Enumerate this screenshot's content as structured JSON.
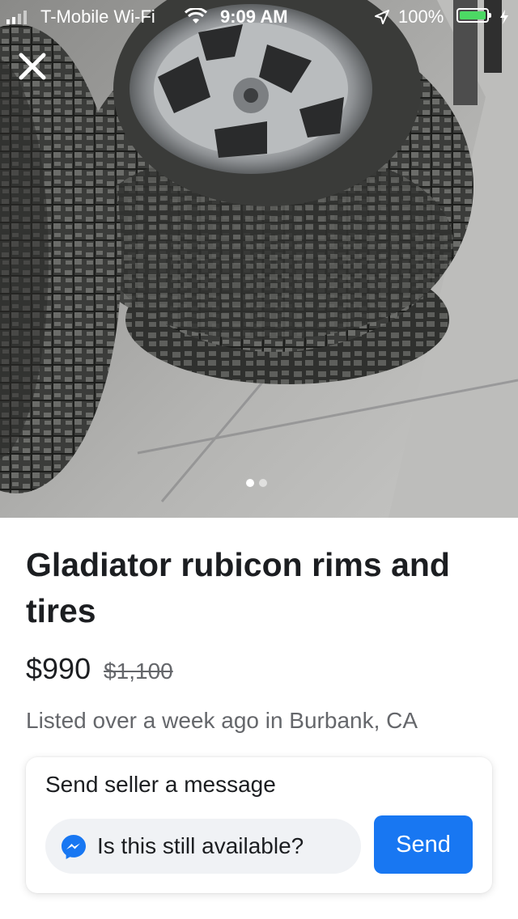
{
  "status_bar": {
    "carrier": "T-Mobile Wi-Fi",
    "time": "9:09 AM",
    "battery": "100%"
  },
  "photo": {
    "page_count": 2,
    "current_page": 1
  },
  "listing": {
    "title": "Gladiator rubicon rims and tires",
    "price": "$990",
    "original_price": "$1,100",
    "listed": "Listed over a week ago in Burbank, CA"
  },
  "message_card": {
    "title": "Send seller a message",
    "input_value": "Is this still available?",
    "send_label": "Send"
  },
  "colors": {
    "accent": "#1877f2",
    "battery": "#4cd964",
    "secondary_text": "#65676b"
  },
  "icons": [
    "signal-icon",
    "wifi-icon",
    "location-arrow-icon",
    "battery-icon",
    "charging-bolt-icon",
    "close-icon",
    "messenger-icon"
  ]
}
